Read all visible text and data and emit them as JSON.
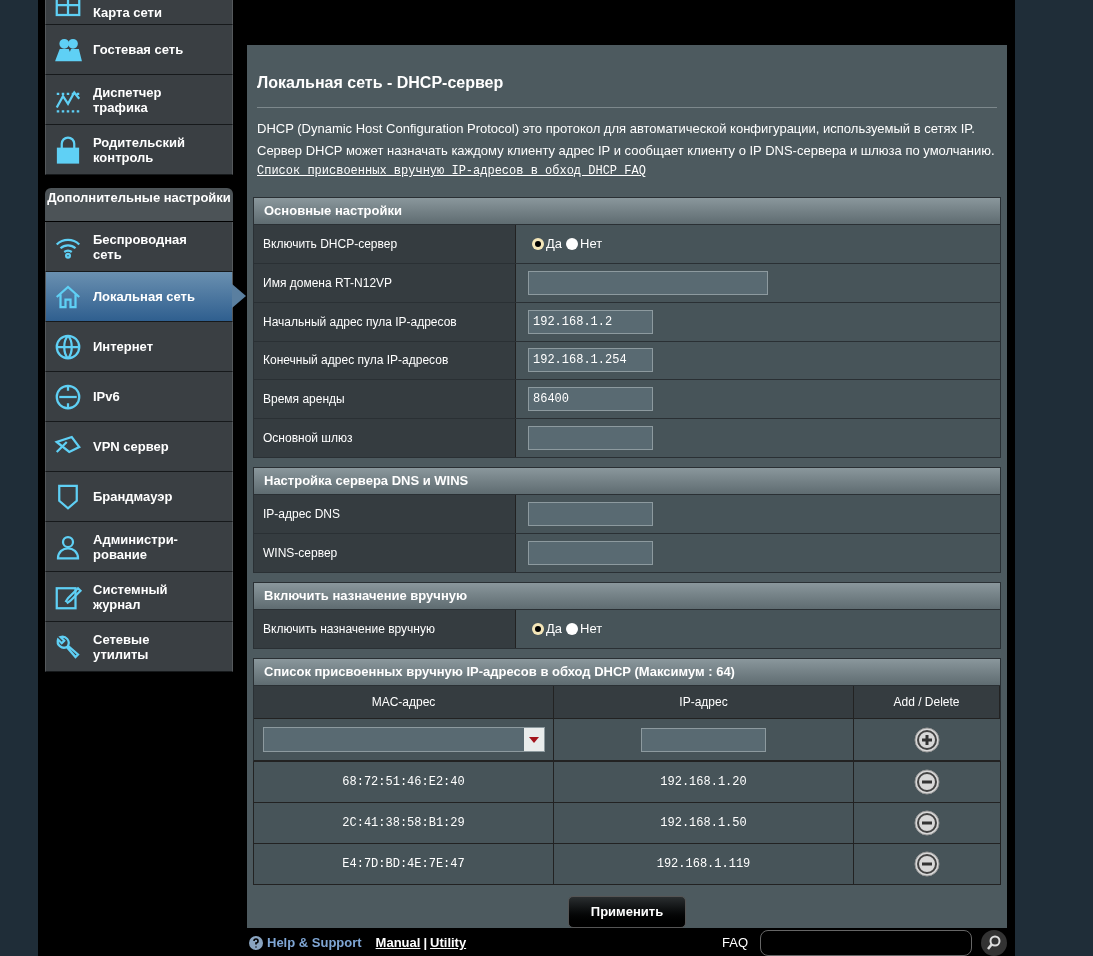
{
  "sidebar": {
    "general_items": [
      {
        "label": "Карта сети",
        "selected": false
      },
      {
        "label": "Гостевая сеть",
        "selected": false
      },
      {
        "label": "Диспетчер трафика",
        "selected": false
      },
      {
        "label": "Родительский контроль",
        "selected": false
      }
    ],
    "advanced_header": "Дополнительные настройки",
    "advanced_items": [
      {
        "label": "Беспроводная сеть",
        "selected": false
      },
      {
        "label": "Локальная сеть",
        "selected": true
      },
      {
        "label": "Интернет",
        "selected": false
      },
      {
        "label": "IPv6",
        "selected": false
      },
      {
        "label": "VPN сервер",
        "selected": false
      },
      {
        "label": "Брандмауэр",
        "selected": false
      },
      {
        "label": "Администри-рование",
        "selected": false
      },
      {
        "label": "Системный журнал",
        "selected": false
      },
      {
        "label": "Сетевые утилиты",
        "selected": false
      }
    ]
  },
  "page": {
    "title": "Локальная сеть - DHCP-сервер",
    "description": [
      "DHCP (Dynamic Host Configuration Protocol) это протокол для автоматической конфигурации, используемый в сетях IP.",
      "Сервер DHCP может назначать каждому клиенту адрес IP и сообщает клиенту о IP DNS-сервера и шлюза по умолчанию."
    ],
    "faq_link": "Список присвоенных вручную IP-адресов в обход DHCP FAQ"
  },
  "sections": [
    {
      "title": "Основные настройки",
      "rows": [
        {
          "label": "Включить DHCP-сервер",
          "kind": "radio",
          "options": [
            {
              "label": "Да",
              "selected": true
            },
            {
              "label": "Нет",
              "selected": false
            }
          ]
        },
        {
          "label": "Имя домена RT-N12VP",
          "kind": "wide_text"
        },
        {
          "label": "Начальный адрес пула IP-адресов",
          "kind": "text",
          "value": "192.168.1.2"
        },
        {
          "label": "Конечный адрес пула IP-адресов",
          "kind": "text",
          "value": "192.168.1.254"
        },
        {
          "label": "Время аренды",
          "kind": "text",
          "value": "86400"
        },
        {
          "label": "Основной шлюз",
          "kind": "text"
        }
      ]
    },
    {
      "title": "Настройка сервера DNS и WINS",
      "rows": [
        {
          "label": "IP-адрес DNS",
          "kind": "text"
        },
        {
          "label": "WINS-сервер",
          "kind": "text"
        }
      ]
    },
    {
      "title": "Включить назначение вручную",
      "rows": [
        {
          "label": "Включить назначение вручную",
          "kind": "radio",
          "options": [
            {
              "label": "Да",
              "selected": true
            },
            {
              "label": "Нет",
              "selected": false
            }
          ]
        }
      ]
    }
  ],
  "manual_list": {
    "title": "Список присвоенных вручную IP-адресов в обход DHCP (Максимум : 64)",
    "columns": [
      "MAC-адрес",
      "IP-адрес",
      "Add / Delete"
    ],
    "rows": [
      {
        "mac": "68:72:51:46:E2:40",
        "ip": "192.168.1.20"
      },
      {
        "mac": "2C:41:38:58:B1:29",
        "ip": "192.168.1.50"
      },
      {
        "mac": "E4:7D:BD:4E:7E:47",
        "ip": "192.168.1.119"
      }
    ]
  },
  "apply_button": "Применить",
  "footer": {
    "help": "Help & Support",
    "links": [
      "Manual",
      "Utility"
    ],
    "separator": "|",
    "faq": "FAQ"
  }
}
